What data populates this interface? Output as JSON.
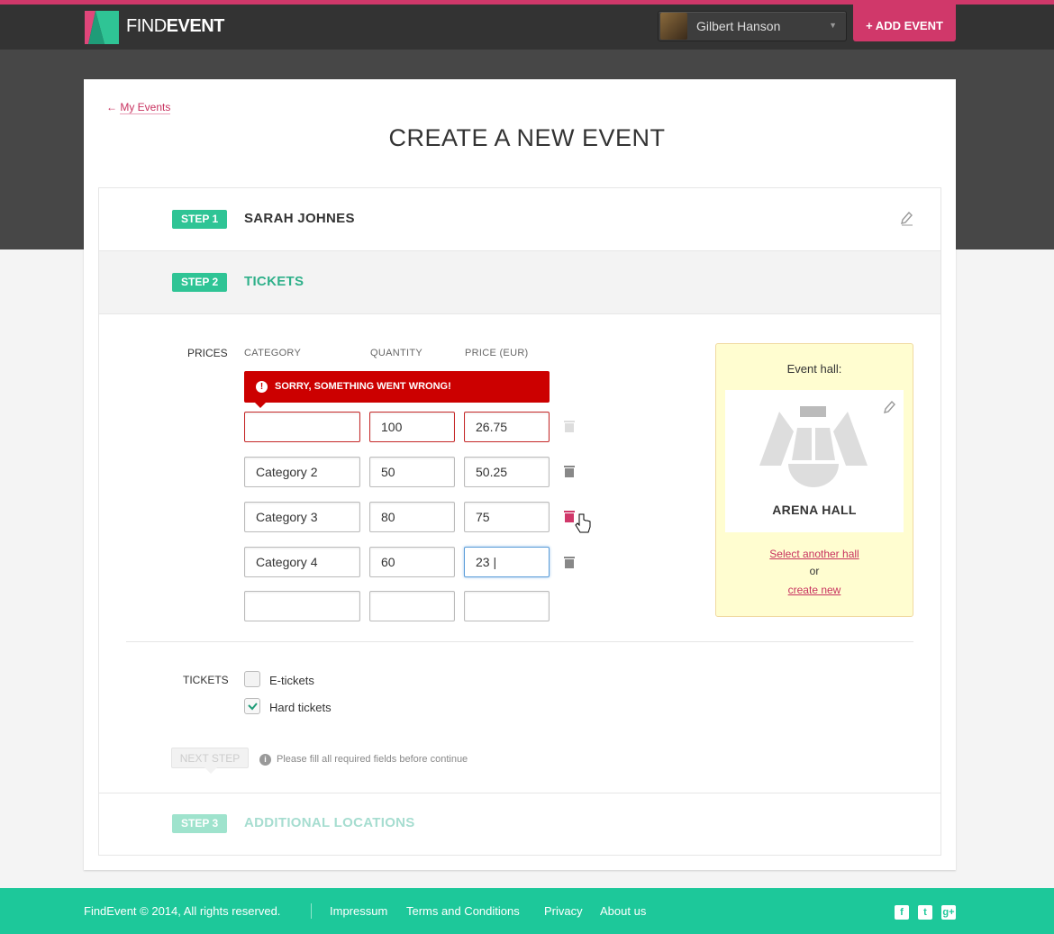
{
  "brand": {
    "name_light": "FIND",
    "name_bold": "EVENT",
    "accent": "#d0386a",
    "green": "#2fc495"
  },
  "header": {
    "user_name": "Gilbert Hanson",
    "add_event_label": "+ ADD EVENT"
  },
  "back_link": "My Events",
  "page_title": "CREATE A NEW EVENT",
  "steps": [
    {
      "badge": "STEP 1",
      "title": "SARAH JOHNES",
      "state": "completed"
    },
    {
      "badge": "STEP 2",
      "title": "TICKETS",
      "state": "active"
    },
    {
      "badge": "STEP 3",
      "title": "ADDITIONAL LOCATIONS",
      "state": "disabled"
    }
  ],
  "prices": {
    "label": "PRICES",
    "columns": [
      "CATEGORY",
      "QUANTITY",
      "PRICE (EUR)"
    ],
    "error": "SORRY, SOMETHING WENT WRONG!",
    "rows": [
      {
        "category": "",
        "quantity": "100",
        "price": "26.75"
      },
      {
        "category": "Category 2",
        "quantity": "50",
        "price": "50.25"
      },
      {
        "category": "Category 3",
        "quantity": "80",
        "price": "75"
      },
      {
        "category": "Category 4",
        "quantity": "60",
        "price": "23 |"
      },
      {
        "category": "",
        "quantity": "",
        "price": ""
      }
    ]
  },
  "hall": {
    "heading": "Event hall:",
    "name": "ARENA HALL",
    "select_link": "Select another hall",
    "or": "or",
    "create_link": "create new"
  },
  "tickets": {
    "label": "TICKETS",
    "options": [
      {
        "label": "E-tickets",
        "checked": false
      },
      {
        "label": "Hard tickets",
        "checked": true
      }
    ]
  },
  "next_step": {
    "label": "NEXT STEP",
    "hint": "Please fill all required fields before continue"
  },
  "footer": {
    "copyright": "FindEvent © 2014, All rights reserved.",
    "links": [
      "Impressum",
      "Terms and Conditions",
      "Privacy",
      "About us"
    ],
    "social": [
      "facebook",
      "twitter",
      "google-plus"
    ]
  }
}
